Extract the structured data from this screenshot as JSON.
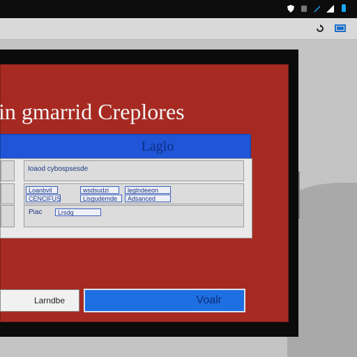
{
  "window": {
    "title": "in gmarrid Creplores"
  },
  "panel": {
    "header": "Laglo",
    "rows": [
      {
        "value": "Ioaod cybospsesde",
        "chips": []
      },
      {
        "value": "",
        "chips": [
          "Loanbvil",
          "wsdsudzi",
          "leglndeeon",
          "CENCIFUS",
          "Lisgudemde",
          "Adsanced"
        ]
      },
      {
        "value": "Piac",
        "chips": [
          "Lrsdg"
        ]
      }
    ]
  },
  "buttons": {
    "secondary": "Larndbe",
    "primary": "Voalr"
  },
  "colors": {
    "window_red": "#a72a22",
    "header_blue": "#1f55d6",
    "primary_blue": "#1d6fe2"
  },
  "icons": [
    "shield-icon",
    "sim-icon",
    "signal-icon",
    "wifi-icon",
    "battery-icon",
    "refresh-icon",
    "window-icon"
  ]
}
